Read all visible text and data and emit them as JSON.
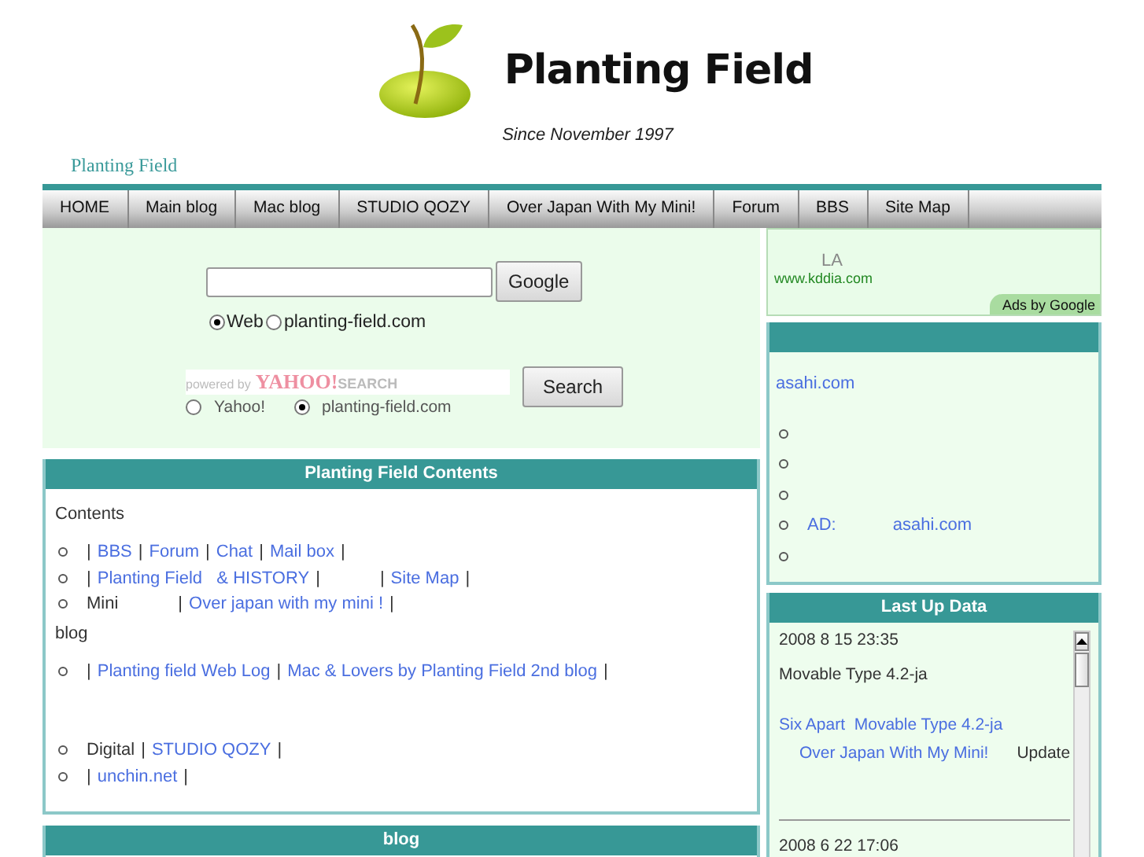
{
  "header": {
    "title": "Planting Field",
    "tagline": "Since November 1997",
    "breadcrumb": "Planting Field"
  },
  "nav": [
    "HOME",
    "Main blog",
    "Mac blog",
    "STUDIO QOZY",
    "Over Japan With My Mini!",
    "Forum",
    "BBS",
    "Site Map"
  ],
  "search": {
    "google_button": "Google",
    "google_options": [
      {
        "label": "Web",
        "selected": true
      },
      {
        "label": "planting-field.com",
        "selected": false
      }
    ],
    "yahoo_logo": {
      "powered": "powered by",
      "brand": "YAHOO!",
      "suffix": "SEARCH"
    },
    "yahoo_button": "Search",
    "yahoo_options": [
      {
        "label": "Yahoo!",
        "selected": false
      },
      {
        "label": "planting-field.com",
        "selected": true
      }
    ]
  },
  "contents": {
    "title": "Planting Field Contents",
    "sections": [
      {
        "heading": "Contents",
        "items": [
          [
            {
              "kind": "text",
              "text": "|"
            },
            {
              "kind": "link",
              "text": "BBS"
            },
            {
              "kind": "text",
              "text": "|"
            },
            {
              "kind": "link",
              "text": "Forum"
            },
            {
              "kind": "text",
              "text": "|"
            },
            {
              "kind": "link",
              "text": "Chat"
            },
            {
              "kind": "text",
              "text": "|"
            },
            {
              "kind": "link",
              "text": "Mail box"
            },
            {
              "kind": "text",
              "text": "|"
            }
          ],
          [
            {
              "kind": "text",
              "text": "|"
            },
            {
              "kind": "link",
              "text": "Planting Field   & HISTORY"
            },
            {
              "kind": "text",
              "text": "|"
            },
            {
              "kind": "gap"
            },
            {
              "kind": "text",
              "text": "|"
            },
            {
              "kind": "link",
              "text": "Site Map"
            },
            {
              "kind": "text",
              "text": "|"
            }
          ],
          [
            {
              "kind": "text",
              "text": "Mini"
            },
            {
              "kind": "gap"
            },
            {
              "kind": "text",
              "text": "|"
            },
            {
              "kind": "link",
              "text": "Over japan with my mini !"
            },
            {
              "kind": "text",
              "text": "|"
            }
          ]
        ]
      },
      {
        "heading": "blog",
        "items": [
          [
            {
              "kind": "text",
              "text": "|"
            },
            {
              "kind": "link",
              "text": "Planting field Web Log"
            },
            {
              "kind": "text",
              "text": "|"
            },
            {
              "kind": "link",
              "text": "Mac & Lovers by Planting Field 2nd blog"
            },
            {
              "kind": "text",
              "text": "|"
            }
          ]
        ]
      },
      {
        "items": [
          [
            {
              "kind": "text",
              "text": "Digital"
            },
            {
              "kind": "text",
              "text": "|"
            },
            {
              "kind": "link",
              "text": "STUDIO QOZY"
            },
            {
              "kind": "text",
              "text": "|"
            }
          ],
          [
            {
              "kind": "text",
              "text": "|"
            },
            {
              "kind": "link",
              "text": "unchin.net"
            },
            {
              "kind": "text",
              "text": "|"
            }
          ]
        ]
      }
    ]
  },
  "blog": {
    "title": "blog"
  },
  "ad": {
    "text": "LA",
    "url": "www.kddia.com",
    "badge": "Ads by Google"
  },
  "news": {
    "link": "asahi.com",
    "items": [
      {
        "kind": "bullet"
      },
      {
        "kind": "bullet"
      },
      {
        "kind": "bullet"
      },
      {
        "kind": "entry",
        "parts": [
          {
            "kind": "link",
            "text": "AD:"
          },
          {
            "kind": "gap"
          },
          {
            "kind": "link",
            "text": "asahi.com"
          }
        ]
      },
      {
        "kind": "bullet"
      }
    ]
  },
  "updates": {
    "title": "Last Up Data",
    "entries": [
      {
        "date": "2008 8 15  23:35",
        "text": "Movable Type 4.2-ja",
        "link": "Six Apart  Movable Type 4.2-ja",
        "sub_link": "Over Japan With My Mini!",
        "note": "Update"
      },
      {
        "date": "2008 6 22  17:06"
      }
    ]
  }
}
